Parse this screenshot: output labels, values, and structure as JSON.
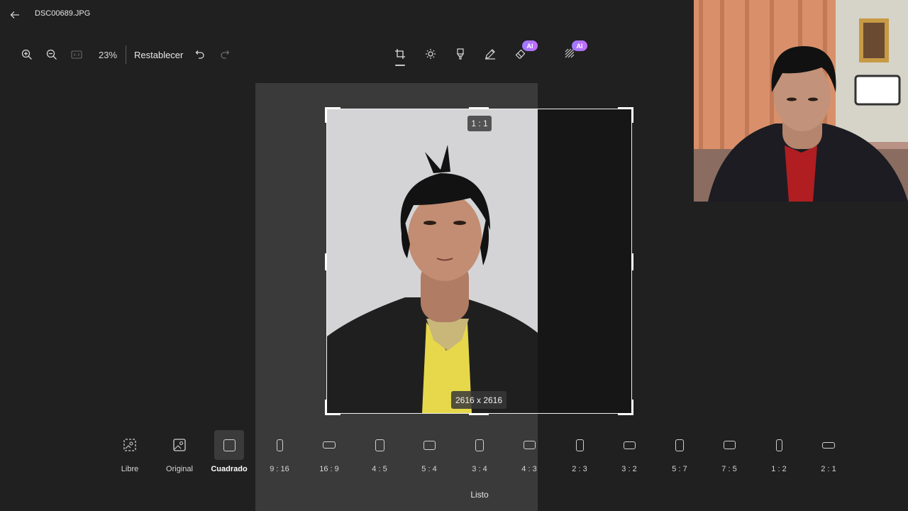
{
  "titlebar": {
    "file_name": "DSC00689.JPG",
    "back_icon": "arrow-left-icon"
  },
  "zoom": {
    "percent": "23%",
    "reset_label": "Restablecer"
  },
  "edit_tools": [
    {
      "name": "crop",
      "icon": "crop-icon",
      "active": true
    },
    {
      "name": "adjust",
      "icon": "brightness-icon"
    },
    {
      "name": "filter",
      "icon": "filter-icon"
    },
    {
      "name": "markup",
      "icon": "pen-icon"
    },
    {
      "name": "erase",
      "icon": "eraser-icon",
      "badge": "AI"
    },
    {
      "name": "background",
      "icon": "background-icon",
      "badge": "AI"
    }
  ],
  "crop": {
    "ratio_label": "1 : 1",
    "dimensions": "2616 x 2616"
  },
  "aspect_ratios": [
    {
      "label": "Libre"
    },
    {
      "label": "Original"
    },
    {
      "label": "Cuadrado",
      "selected": true
    },
    {
      "label": "9 : 16"
    },
    {
      "label": "16 : 9"
    },
    {
      "label": "4 : 5"
    },
    {
      "label": "5 : 4"
    },
    {
      "label": "3 : 4"
    },
    {
      "label": "4 : 3"
    },
    {
      "label": "2 : 3"
    },
    {
      "label": "3 : 2"
    },
    {
      "label": "5 : 7"
    },
    {
      "label": "7 : 5"
    },
    {
      "label": "1 : 2"
    },
    {
      "label": "2 : 1"
    }
  ],
  "done_label": "Listo",
  "colors": {
    "background": "#202020",
    "ai_badge": "#b070ff",
    "selected_tile": "#3b3b3b"
  }
}
